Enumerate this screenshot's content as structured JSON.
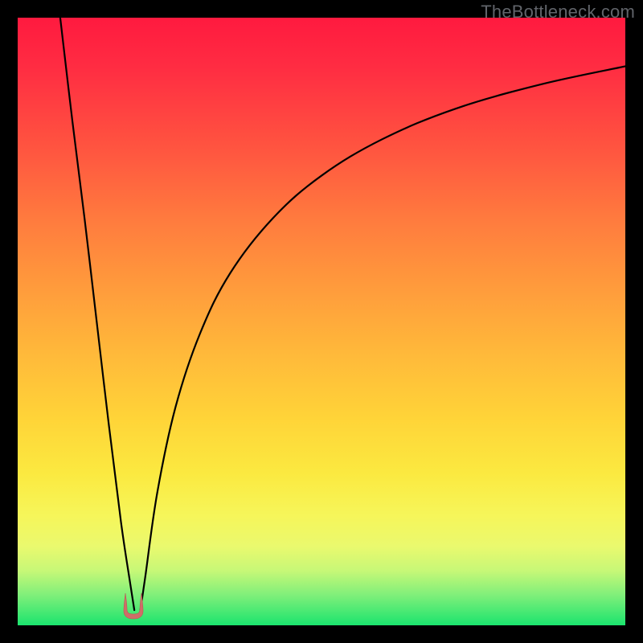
{
  "watermark": "TheBottleneck.com",
  "colors": {
    "frame": "#000000",
    "curve": "#000000",
    "marker": "#cf6d68",
    "gradient_stops": [
      "#ff1a3f",
      "#ff2c42",
      "#ff5640",
      "#ff7a3e",
      "#ff9a3c",
      "#ffb83a",
      "#ffd438",
      "#fbe940",
      "#f6f65a",
      "#eaf96e",
      "#c7f877",
      "#80ef7a",
      "#1be46e"
    ]
  },
  "chart_data": {
    "type": "line",
    "title": "",
    "xlabel": "",
    "ylabel": "",
    "xlim": [
      0,
      100
    ],
    "ylim": [
      0,
      100
    ],
    "grid": false,
    "note": "Axes are unlabeled; values are relative percentages read off the plot area. 0 on the y-axis is the bottom (green) edge, 100 is the top (red) edge.",
    "marker": {
      "x": 19,
      "y": 2,
      "shape": "u",
      "color": "#cf6d68"
    },
    "series": [
      {
        "name": "left-branch",
        "x": [
          7,
          9,
          11,
          13,
          15,
          17,
          18.5,
          19.2
        ],
        "values": [
          100,
          83,
          67,
          50,
          33,
          17,
          7,
          2.5
        ]
      },
      {
        "name": "right-branch",
        "x": [
          20.2,
          21,
          23,
          26,
          30,
          35,
          42,
          50,
          60,
          72,
          86,
          100
        ],
        "values": [
          2.5,
          8,
          22,
          36,
          48,
          58,
          67,
          74,
          80,
          85,
          89,
          92
        ]
      }
    ]
  }
}
